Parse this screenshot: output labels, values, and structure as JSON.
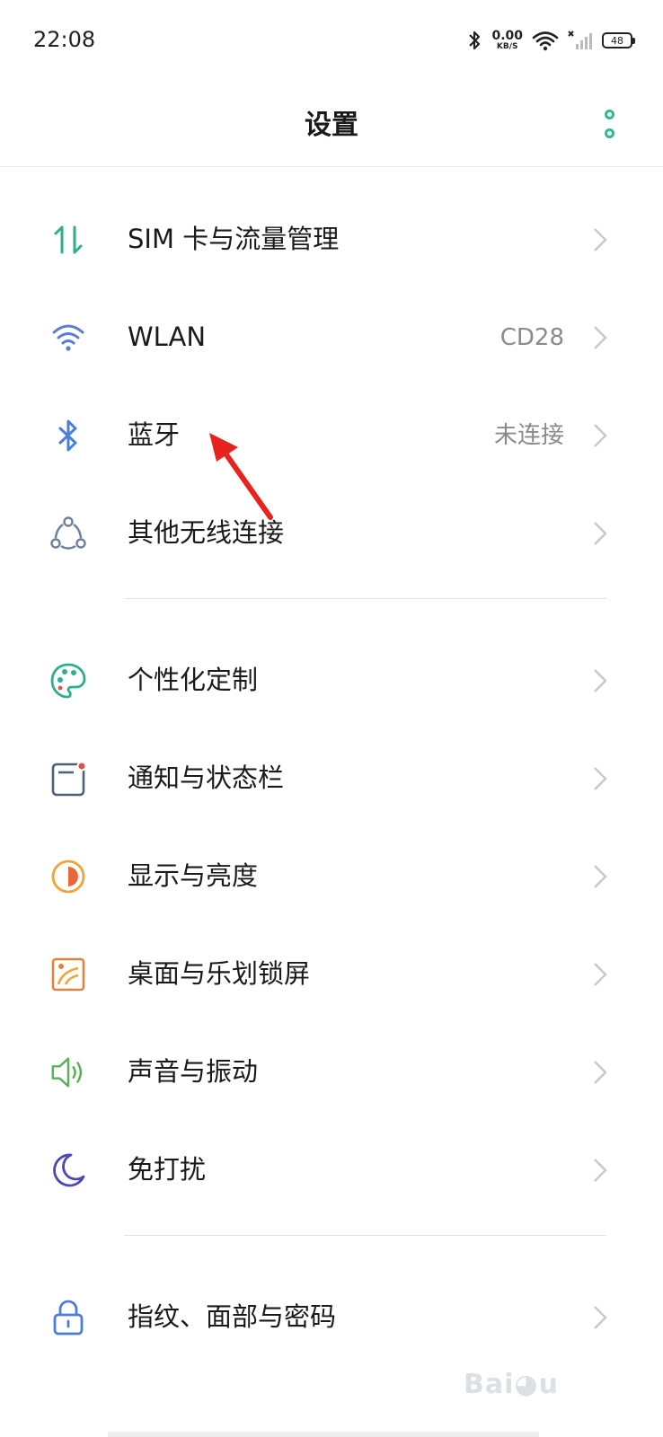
{
  "status_bar": {
    "time": "22:08",
    "net_speed_value": "0.00",
    "net_speed_unit": "KB/S",
    "battery_level": "48",
    "icons": [
      "bluetooth-icon",
      "wifi-icon",
      "cellular-signal-icon",
      "battery-icon"
    ]
  },
  "header": {
    "title": "设置",
    "more_icon": "more-vertical-icon",
    "accent_color": "#2fba8d"
  },
  "groups": [
    {
      "items": [
        {
          "id": "sim",
          "label": "SIM 卡与流量管理",
          "value": "",
          "icon": "sim-data-icon",
          "color": "#2fae8e"
        },
        {
          "id": "wlan",
          "label": "WLAN",
          "value": "CD28",
          "icon": "wifi-icon",
          "color": "#5b7bd5"
        },
        {
          "id": "bluetooth",
          "label": "蓝牙",
          "value": "未连接",
          "icon": "bluetooth-icon",
          "color": "#4a7ed8"
        },
        {
          "id": "other-wireless",
          "label": "其他无线连接",
          "value": "",
          "icon": "wireless-connections-icon",
          "color": "#6b7f9a"
        }
      ]
    },
    {
      "items": [
        {
          "id": "personalize",
          "label": "个性化定制",
          "value": "",
          "icon": "palette-icon",
          "color": "#2fae8e"
        },
        {
          "id": "notifications",
          "label": "通知与状态栏",
          "value": "",
          "icon": "notification-icon",
          "color": "#4f6178"
        },
        {
          "id": "display",
          "label": "显示与亮度",
          "value": "",
          "icon": "brightness-icon",
          "color": "#f0a33a"
        },
        {
          "id": "desktop",
          "label": "桌面与乐划锁屏",
          "value": "",
          "icon": "wallpaper-icon",
          "color": "#e0833c"
        },
        {
          "id": "sound",
          "label": "声音与振动",
          "value": "",
          "icon": "speaker-icon",
          "color": "#58b25a"
        },
        {
          "id": "dnd",
          "label": "免打扰",
          "value": "",
          "icon": "moon-icon",
          "color": "#4b47b5"
        }
      ]
    },
    {
      "items": [
        {
          "id": "security",
          "label": "指纹、面部与密码",
          "value": "",
          "icon": "lock-icon",
          "color": "#4a7ed8"
        }
      ]
    }
  ]
}
